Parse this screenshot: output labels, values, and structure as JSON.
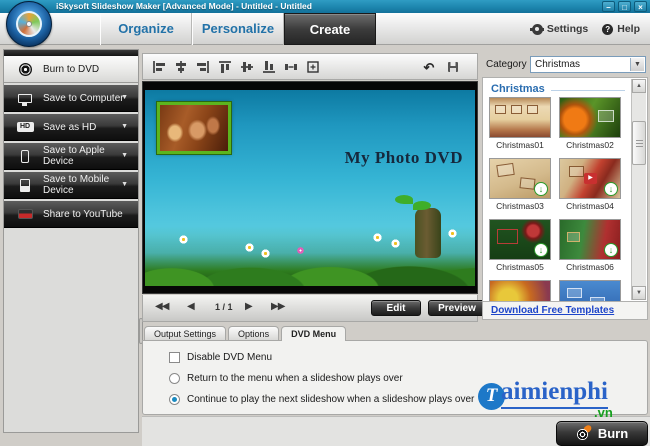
{
  "window": {
    "title": "iSkysoft Slideshow Maker [Advanced Mode] - Untitled - Untitled",
    "minimize": "–",
    "maximize": "□",
    "close": "×"
  },
  "header": {
    "tabs": [
      "Organize",
      "Personalize",
      "Create"
    ],
    "active_tab": "Create",
    "settings": "Settings",
    "help": "Help"
  },
  "sidebar": {
    "items": [
      {
        "label": "Burn to DVD",
        "icon": "disc-icon",
        "selected": true
      },
      {
        "label": "Save to Computer",
        "icon": "computer-icon",
        "has_submenu": true
      },
      {
        "label": "Save as HD",
        "icon": "hd-icon",
        "has_submenu": true
      },
      {
        "label": "Save to Apple Device",
        "icon": "apple-device-icon",
        "has_submenu": true
      },
      {
        "label": "Save to Mobile Device",
        "icon": "mobile-device-icon",
        "has_submenu": true
      },
      {
        "label": "Share to YouTube",
        "icon": "youtube-icon",
        "has_submenu": false
      }
    ]
  },
  "toolbar": {
    "icons": [
      "align-left",
      "align-center-horizontal",
      "align-right",
      "align-top",
      "align-middle-vertical",
      "align-bottom",
      "distribute-horizontal",
      "match-size",
      "undo",
      "save"
    ]
  },
  "preview": {
    "menu_title": "My Photo DVD",
    "page_indicator": "1 / 1",
    "first": "◀◀",
    "prev": "◀",
    "next": "▶",
    "last": "▶▶",
    "edit": "Edit",
    "preview": "Preview"
  },
  "output": {
    "tabs": [
      "Output Settings",
      "Options",
      "DVD Menu"
    ],
    "active_tab": "DVD Menu",
    "disable_label": "Disable DVD Menu",
    "disable_checked": false,
    "radio_return": "Return to the menu when a slideshow plays over",
    "radio_continue": "Continue to play the next slideshow when a slideshow plays over",
    "radio_selected": "Continue to play the next slideshow when a slideshow plays over"
  },
  "templates": {
    "category_label": "Category",
    "category_value": "Christmas",
    "section_title": "Christmas",
    "items": [
      {
        "name": "Christmas01",
        "downloadable": false
      },
      {
        "name": "Christmas02",
        "downloadable": false
      },
      {
        "name": "Christmas03",
        "downloadable": true
      },
      {
        "name": "Christmas04",
        "downloadable": true
      },
      {
        "name": "Christmas05",
        "downloadable": true
      },
      {
        "name": "Christmas06",
        "downloadable": true
      },
      {
        "name": "",
        "downloadable": false
      },
      {
        "name": "",
        "downloadable": false
      }
    ],
    "download_link": "Download Free Templates"
  },
  "burn": {
    "label": "Burn"
  },
  "watermark": {
    "initial": "T",
    "rest": "aimienphi",
    "domain": ".vn"
  },
  "colors": {
    "titlebar": "#1d86ae",
    "accent_blue": "#2272a8",
    "link_blue": "#1d45c9",
    "radio_selected": "#1a8ac0",
    "watermark_blue": "#2a63c8",
    "watermark_green": "#17a01f"
  }
}
